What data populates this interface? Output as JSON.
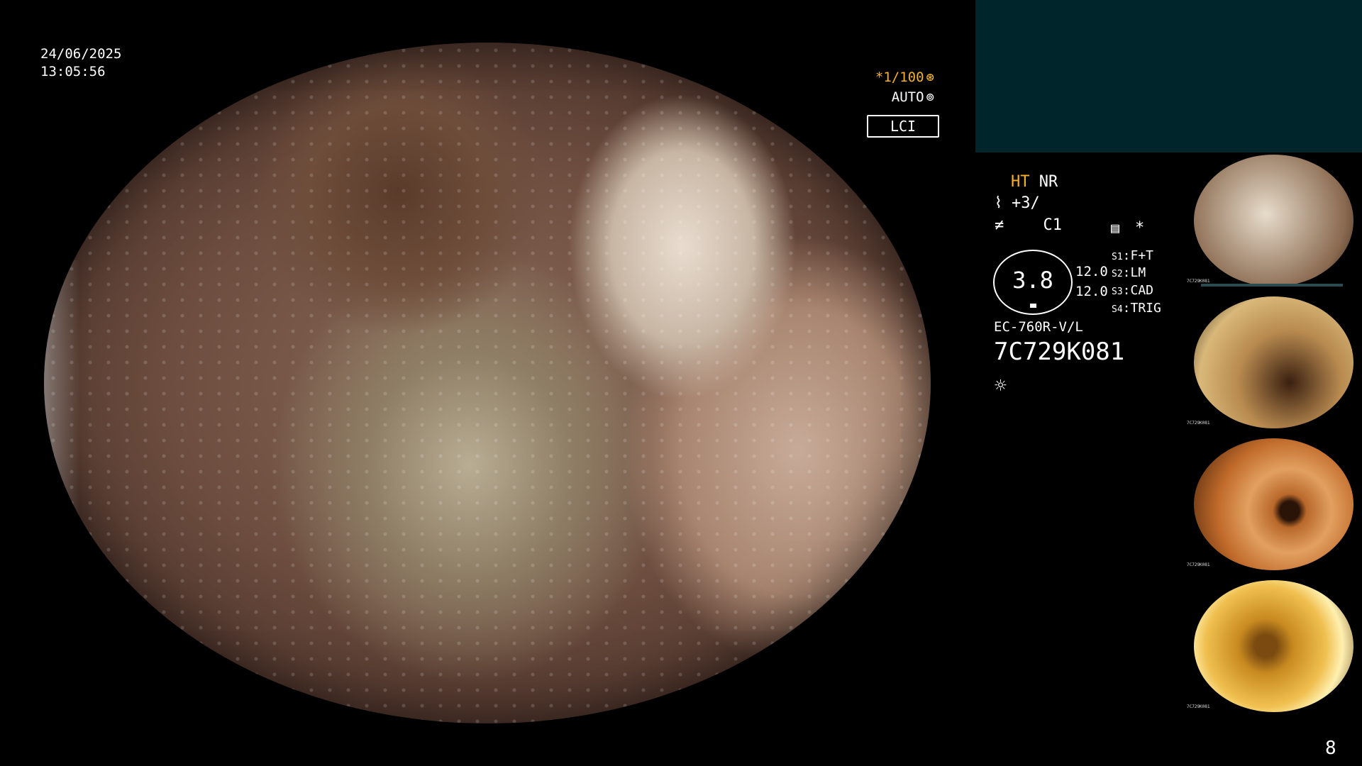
{
  "datetime": {
    "date": "24/06/2025",
    "time": "13:05:56"
  },
  "overlay": {
    "shutter": "*1/100",
    "auto": "AUTO",
    "mode": "LCI"
  },
  "info": {
    "ht": "HT",
    "nr": "NR",
    "structure": "+3/",
    "color": "C1",
    "gauge_value": "3.8",
    "gauge_num1": "12.0",
    "gauge_num2": "12.0",
    "s1": {
      "key": "S1",
      "val": ":F+T"
    },
    "s2": {
      "key": "S2",
      "val": ":LM"
    },
    "s3": {
      "key": "S3",
      "val": ":CAD"
    },
    "s4": {
      "key": "S4",
      "val": ":TRIG"
    },
    "model": "EC-760R-V/L",
    "serial": "7C729K081"
  },
  "thumbnails": [
    {
      "label": "7C729K081",
      "color": "#c9b49a"
    },
    {
      "label": "7C729K081",
      "color": "#c9a060"
    },
    {
      "label": "7C729K081",
      "color": "#d88a3c"
    },
    {
      "label": "7C729K081",
      "color": "#e0a030"
    }
  ],
  "page_number": "8"
}
